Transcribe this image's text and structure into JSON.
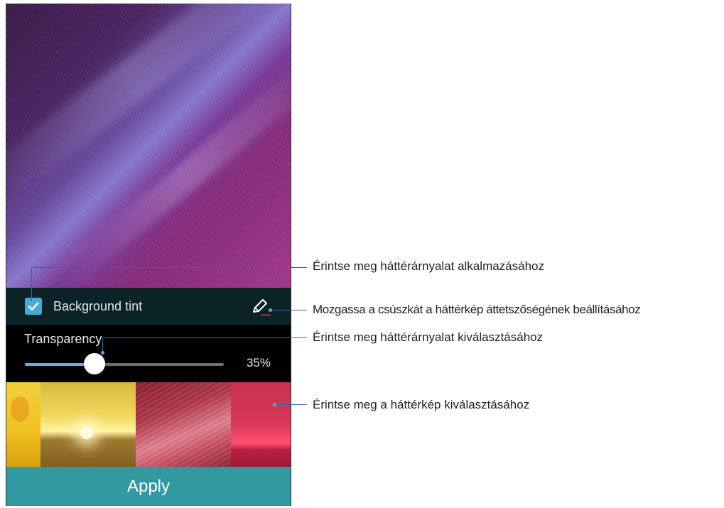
{
  "tint": {
    "label": "Background tint",
    "checked": true
  },
  "transparency": {
    "label": "Transparency",
    "value_text": "35%",
    "value": 0.35
  },
  "apply": {
    "label": "Apply"
  },
  "callouts": [
    "Érintse meg háttérárnyalat alkalmazásához",
    "Mozgassa a csúszkát a háttérkép áttetszőségének beállításához",
    "Érintse meg háttérárnyalat kiválasztásához",
    "Érintse meg a háttérkép kiválasztásához"
  ],
  "icons": {
    "checkbox": "check-icon",
    "edit": "pencil-icon"
  },
  "colors": {
    "accent": "#3399a0",
    "slider": "#5fb4de",
    "checkbox": "#4aa8d8"
  }
}
